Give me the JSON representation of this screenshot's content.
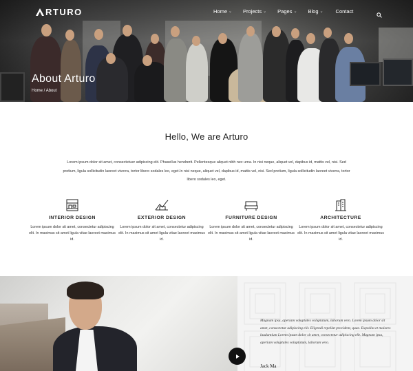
{
  "brand": {
    "logo_text": "RTURO",
    "logo_mark": "A"
  },
  "nav": {
    "items": [
      {
        "label": "Home",
        "dropdown": true
      },
      {
        "label": "Projects",
        "dropdown": true
      },
      {
        "label": "Pages",
        "dropdown": true
      },
      {
        "label": "Blog",
        "dropdown": true
      },
      {
        "label": "Contact",
        "dropdown": false
      }
    ],
    "search_icon": "search-icon",
    "chevron": "⌄"
  },
  "hero": {
    "title": "About Arturo",
    "breadcrumb_home": "Home",
    "breadcrumb_sep": " / ",
    "breadcrumb_current": "About"
  },
  "about": {
    "heading": "Hello, We are Arturo",
    "lead": "Lorem ipsum dolor sit amet, consectetuer adipiscing elit. Phasellus hendrerit. Pellentesque aliquet nibh nec urna. In nisi neque, aliquet vel, dapibus id, mattis vel, nisi. Sed pretium, ligula sollicitudin laoreet viverra, tortor libero sodales leo, eget.In nisi neque, aliquet vel, dapibus id, mattis vel, nisi. Sed pretium, ligula sollicitudin laoreet viverra, tortor libero sodales leo, eget."
  },
  "services": [
    {
      "icon": "interior-design-icon",
      "title": "INTERIOR DESIGN",
      "text": "Lorem ipsum dolor sit amet, consectetur adipiscing elit. In maximus sit amet ligula vitae laoreet maximus id."
    },
    {
      "icon": "exterior-design-icon",
      "title": "EXTERIOR DESIGN",
      "text": "Lorem ipsum dolor sit amet, consectetur adipiscing elit. In maximus sit amet ligula vitae laoreet maximus id."
    },
    {
      "icon": "furniture-design-icon",
      "title": "FURNITURE DESIGN",
      "text": "Lorem ipsum dolor sit amet, consectetur adipiscing elit. In maximus sit amet ligula vitae laoreet maximus id."
    },
    {
      "icon": "architecture-icon",
      "title": "ARCHITECTURE",
      "text": "Lorem ipsum dolor sit amet, consectetur adipiscing elit. In maximus sit amet ligula vitae laoreet maximus id."
    }
  ],
  "testimonial": {
    "quote": "Magnam ipsa, aperiam voluptates voluptatum, laborum vero. Lorem ipsum dolor sit amet, consectetur adipiscing elit. Eligendi repellat provident, quae. Expedita et maiores laudantium Lorem ipsum dolor sit amet, consectetur adipiscing elit. Magnam ipsa, aperiam voluptates voluptatum, laborum vero.",
    "author": "Jack Ma",
    "play_icon": "play-icon"
  },
  "colors": {
    "accent": "#111111",
    "text": "#222222",
    "light_bg": "#f4f4f4"
  }
}
